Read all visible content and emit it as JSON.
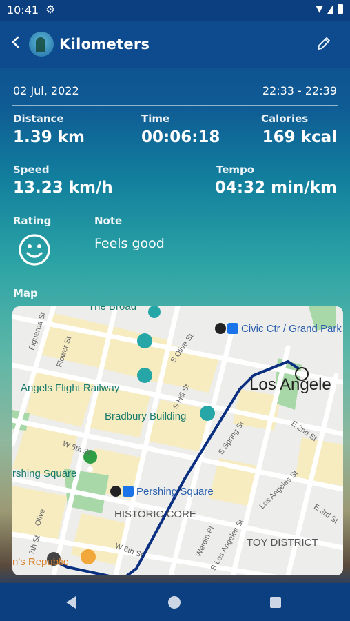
{
  "status": {
    "time": "10:41"
  },
  "header": {
    "title": "Kilometers"
  },
  "activity": {
    "date": "02 Jul, 2022",
    "time_range": "22:33 - 22:39",
    "distance_label": "Distance",
    "distance": "1.39 km",
    "time_label": "Time",
    "time": "00:06:18",
    "calories_label": "Calories",
    "calories": "169 kcal",
    "speed_label": "Speed",
    "speed": "13.23 km/h",
    "tempo_label": "Tempo",
    "tempo": "04:32 min/km",
    "rating_label": "Rating",
    "note_label": "Note",
    "note": "Feels good",
    "map_label": "Map"
  },
  "map": {
    "places": {
      "the_broad": "The Broad",
      "civic_center": "Civic Ctr / Grand Park",
      "angels_flight": "Angels Flight Railway",
      "bradbury": "Bradbury Building",
      "los_angeles": "Los Angele",
      "pershing_square_park": "rshing Square",
      "pershing_square_station": "Pershing Square",
      "historic_core": "HISTORIC CORE",
      "toy_district": "TOY DISTRICT",
      "republic": "n's Republic"
    },
    "streets": {
      "figueroa": "Figueroa St",
      "flower": "Flower St",
      "olive": "S Olive St",
      "hill": "S Hill St",
      "w5th": "W 5th St",
      "w6th": "W 6th St",
      "spring": "S Spring St",
      "e2nd": "E 2nd St",
      "e3rd": "E 3rd St",
      "los_angeles_st": "Los Angeles St",
      "werdin": "Werdin Pl",
      "s_los_angeles": "S Los Angeles St",
      "olive2": "Olive",
      "seventh": "7th St"
    },
    "colors": {
      "route": "#0b2f80",
      "park": "#a8d8a8",
      "block": "#f7ecc0"
    }
  }
}
